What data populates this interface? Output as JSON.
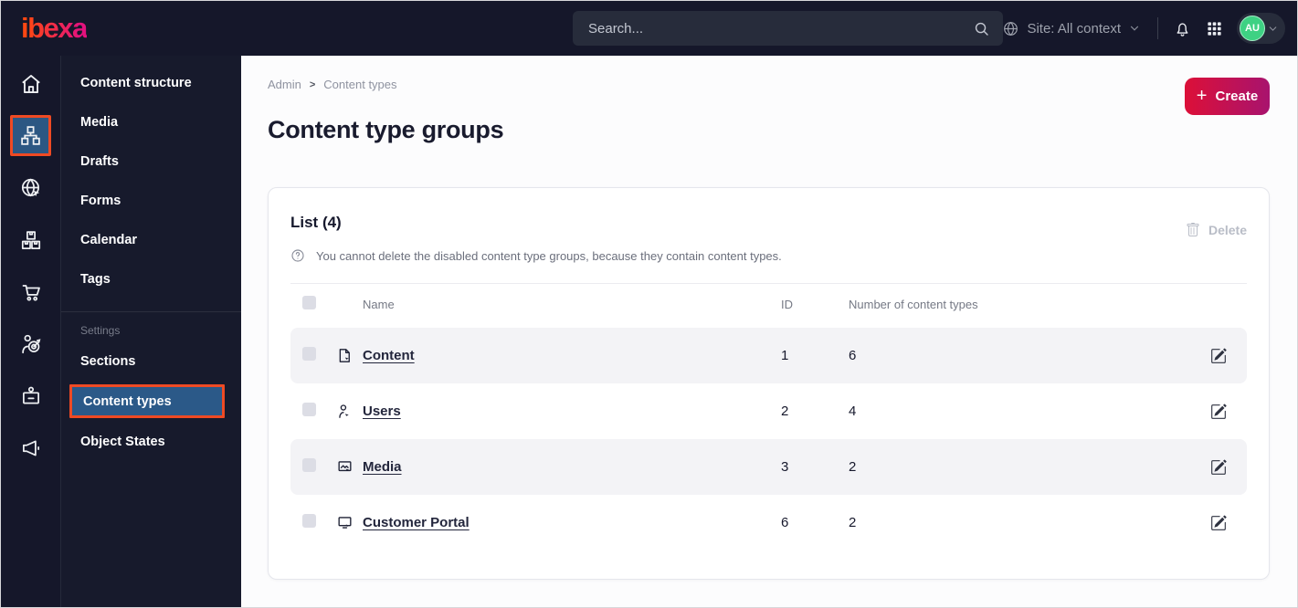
{
  "topbar": {
    "logo": "ibexa",
    "search": {
      "placeholder": "Search..."
    },
    "site_selector": {
      "label": "Site: All context"
    },
    "user_menu": {
      "initials": "AU"
    }
  },
  "icon_rail": {
    "items": [
      {
        "name": "dashboard",
        "icon": "home-icon",
        "active": false
      },
      {
        "name": "content",
        "icon": "content-structure-icon",
        "active": true
      },
      {
        "name": "site",
        "icon": "globe-cursor-icon",
        "active": false
      },
      {
        "name": "product-catalog",
        "icon": "boxes-icon",
        "active": false
      },
      {
        "name": "commerce",
        "icon": "cart-icon",
        "active": false
      },
      {
        "name": "personalization",
        "icon": "person-target-icon",
        "active": false
      },
      {
        "name": "admin",
        "icon": "badge-icon",
        "active": false
      },
      {
        "name": "marketing",
        "icon": "megaphone-icon",
        "active": false
      }
    ]
  },
  "sidebar": {
    "items": [
      {
        "label": "Content structure"
      },
      {
        "label": "Media"
      },
      {
        "label": "Drafts"
      },
      {
        "label": "Forms"
      },
      {
        "label": "Calendar"
      },
      {
        "label": "Tags"
      }
    ],
    "settings_heading": "Settings",
    "settings_items": [
      {
        "label": "Sections",
        "active": false
      },
      {
        "label": "Content types",
        "active": true
      },
      {
        "label": "Object States",
        "active": false
      }
    ]
  },
  "main": {
    "breadcrumb": {
      "items": [
        "Admin",
        "Content types"
      ],
      "separator": ">"
    },
    "create_button": {
      "plus": "+",
      "label": "Create"
    },
    "page_title": "Content type groups",
    "list_card": {
      "title": "List (4)",
      "info_text": "You cannot delete the disabled content type groups, because they contain content types.",
      "delete_button": {
        "label": "Delete",
        "disabled": true
      },
      "table": {
        "columns": {
          "name": "Name",
          "id": "ID",
          "count": "Number of content types"
        },
        "rows": [
          {
            "icon": "file-edit-icon",
            "name": "Content",
            "id": "1",
            "count": "6"
          },
          {
            "icon": "user-edit-icon",
            "name": "Users",
            "id": "2",
            "count": "4"
          },
          {
            "icon": "image-edit-icon",
            "name": "Media",
            "id": "3",
            "count": "2"
          },
          {
            "icon": "monitor-edit-icon",
            "name": "Customer Portal",
            "id": "6",
            "count": "2"
          }
        ]
      }
    }
  },
  "colors": {
    "topbar_bg": "#15172a",
    "sidebar_bg": "#171a2c",
    "active_highlight_border": "#ef4a23",
    "active_highlight_bg": "#2b5988",
    "create_gradient_start": "#dc1038",
    "create_gradient_end": "#a8136e",
    "logo_gradient_start": "#ff4713",
    "logo_gradient_end": "#e4127d",
    "avatar_bg": "#3ed183",
    "row_stripe": "#f3f3f6"
  }
}
